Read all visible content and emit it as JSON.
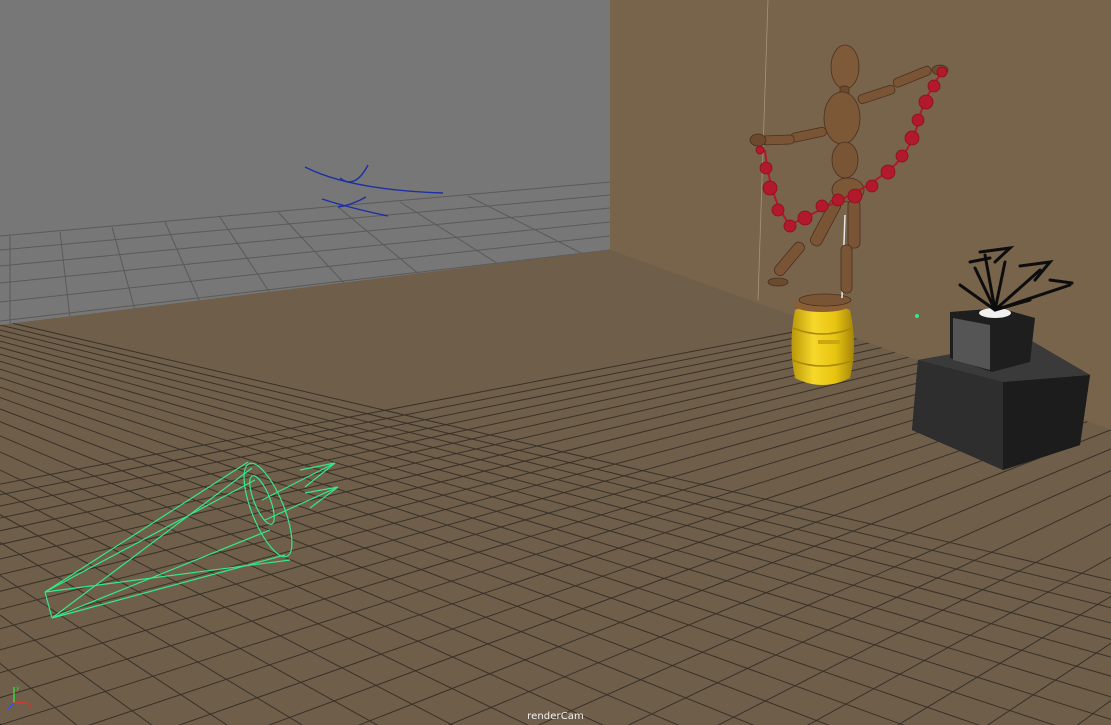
{
  "viewport": {
    "camera_name": "renderCam",
    "background_wall_color": "#7a7a7a",
    "side_wall_color": "#78634b",
    "floor_color": "#6e5d48",
    "grid_line_color": "#2f2a24"
  },
  "objects": [
    {
      "id": "wooden-mannequin",
      "icon": "mannequin-figure",
      "color": "#7a5535"
    },
    {
      "id": "red-garland",
      "icon": "vine-decoration",
      "color": "#b2192b"
    },
    {
      "id": "yellow-barrel",
      "icon": "barrel",
      "color": "#f2cf15"
    },
    {
      "id": "black-pedestal",
      "icon": "box",
      "color": "#232323"
    },
    {
      "id": "black-plant",
      "icon": "plant-silhouette",
      "color": "#111111"
    },
    {
      "id": "spotlight-gizmo",
      "icon": "light-cone-wireframe",
      "color": "#35e88a"
    },
    {
      "id": "light-direction-arrows",
      "icon": "directional-light-arrows",
      "color": "#1e2fa3"
    }
  ],
  "axis_gizmo": {
    "x_color": "#e03030",
    "y_color": "#3ad03a",
    "z_color": "#3050ff"
  }
}
